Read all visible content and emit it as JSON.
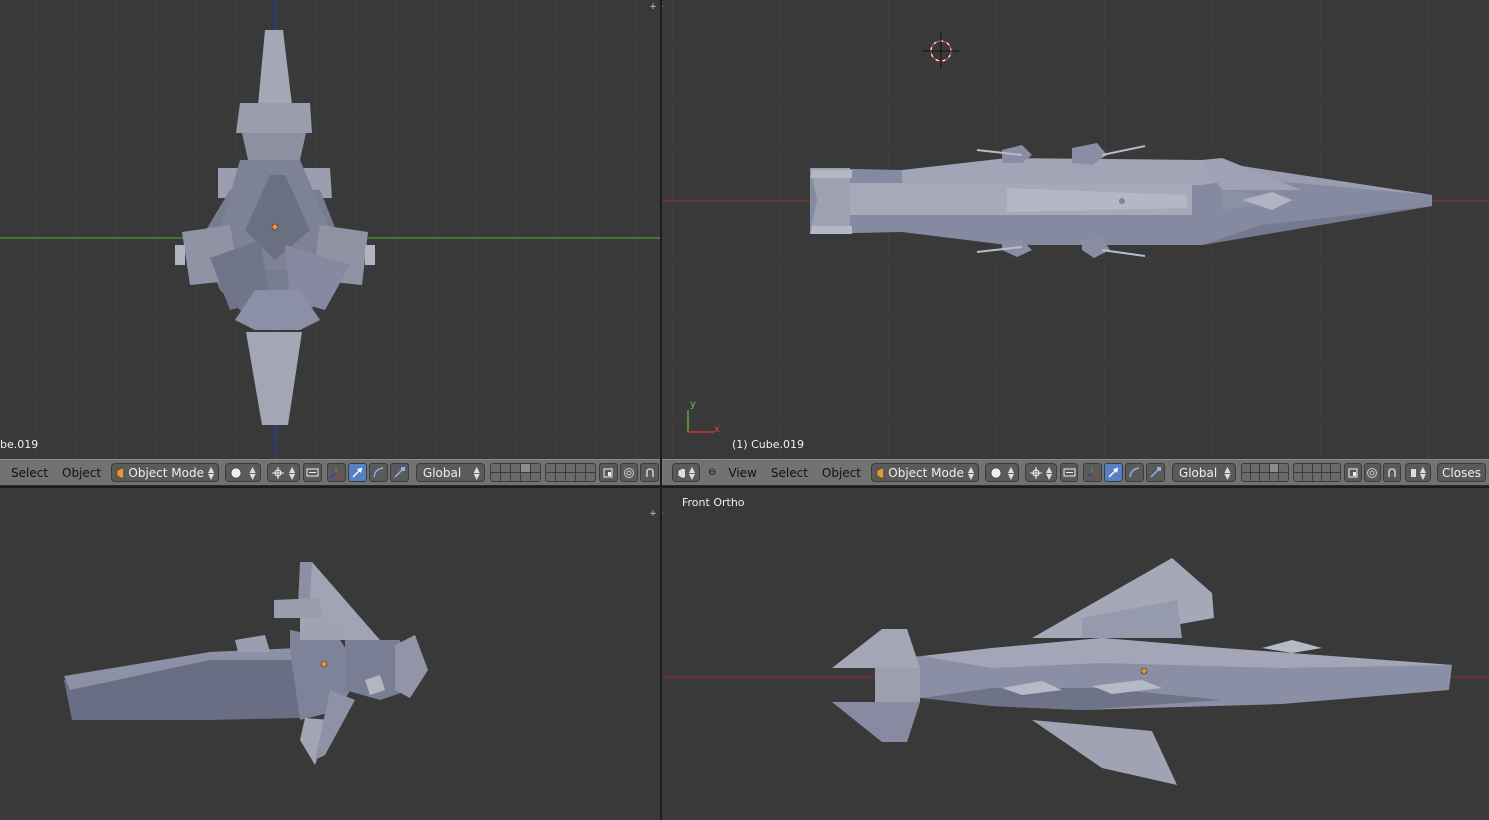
{
  "viewports": {
    "top_left": {
      "label": "be.019"
    },
    "top_right": {
      "label": "(1) Cube.019"
    },
    "bottom_right": {
      "label": "Front Ortho"
    }
  },
  "header_left": {
    "select": "Select",
    "object": "Object",
    "mode": "Object Mode",
    "orientation": "Global"
  },
  "header_right": {
    "view": "View",
    "select": "Select",
    "object": "Object",
    "mode": "Object Mode",
    "orientation": "Global",
    "snap": "Closes"
  },
  "axis_labels": {
    "y": "y",
    "x": "x"
  },
  "colors": {
    "viewport_bg": "#393939",
    "header_bg": "#727272",
    "x_axis": "#8a2e2e",
    "y_axis": "#4a8a2e",
    "z_axis": "#2e3a9a",
    "mesh_light": "#a4a7b6",
    "mesh_dark": "#6e7286"
  },
  "icons": [
    "object-cube-icon",
    "shading-sphere-icon",
    "pivot-icon",
    "manipulator-translate-icon",
    "manipulator-rotate-icon",
    "manipulator-scale-icon",
    "render-icon",
    "proportional-icon",
    "snap-magnet-icon",
    "viewport-3d-icon"
  ]
}
